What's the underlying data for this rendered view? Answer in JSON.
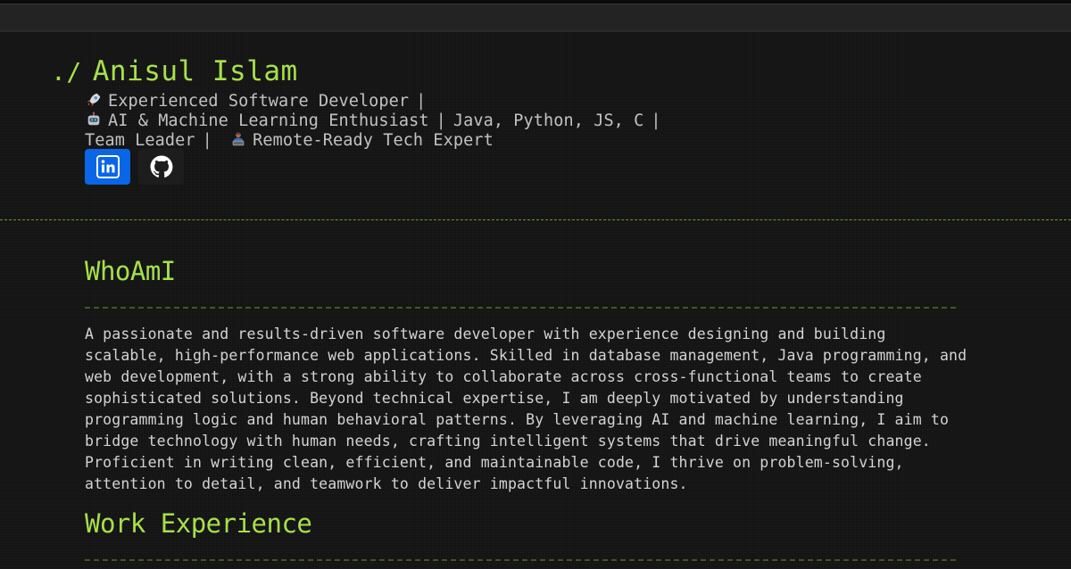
{
  "header": {
    "prompt": "./",
    "name": "Anisul Islam",
    "tagline": {
      "part1": "Experienced Software Developer",
      "part2": "AI & Machine Learning Enthusiast",
      "part3": "Java, Python, JS, C",
      "part4": "Team Leader",
      "part5": "Remote-Ready Tech Expert",
      "separator": "|",
      "icons": [
        "rocket-icon",
        "robot-icon",
        "technologist-icon"
      ]
    }
  },
  "socials": [
    {
      "name": "LinkedIn",
      "icon": "linkedin-icon",
      "color": "#0a66e6"
    },
    {
      "name": "GitHub",
      "icon": "github-icon",
      "color": "#1d1d1d"
    }
  ],
  "about": {
    "title": "WhoAmI",
    "text": "A passionate and results-driven software developer with experience designing and building scalable, high-performance web applications. Skilled in database management, Java programming, and web development, with a strong ability to collaborate across cross-functional teams to create sophisticated solutions. Beyond technical expertise, I am deeply motivated by understanding programming logic and human behavioral patterns. By leveraging AI and machine learning, I aim to bridge technology with human needs, crafting intelligent systems that drive meaningful change. Proficient in writing clean, efficient, and maintainable code, I thrive on problem-solving, attention to detail, and teamwork to deliver impactful innovations."
  },
  "work": {
    "title": "Work Experience"
  },
  "colors": {
    "accent": "#a6e04a",
    "background": "#141414",
    "text": "#d4d4d4"
  }
}
